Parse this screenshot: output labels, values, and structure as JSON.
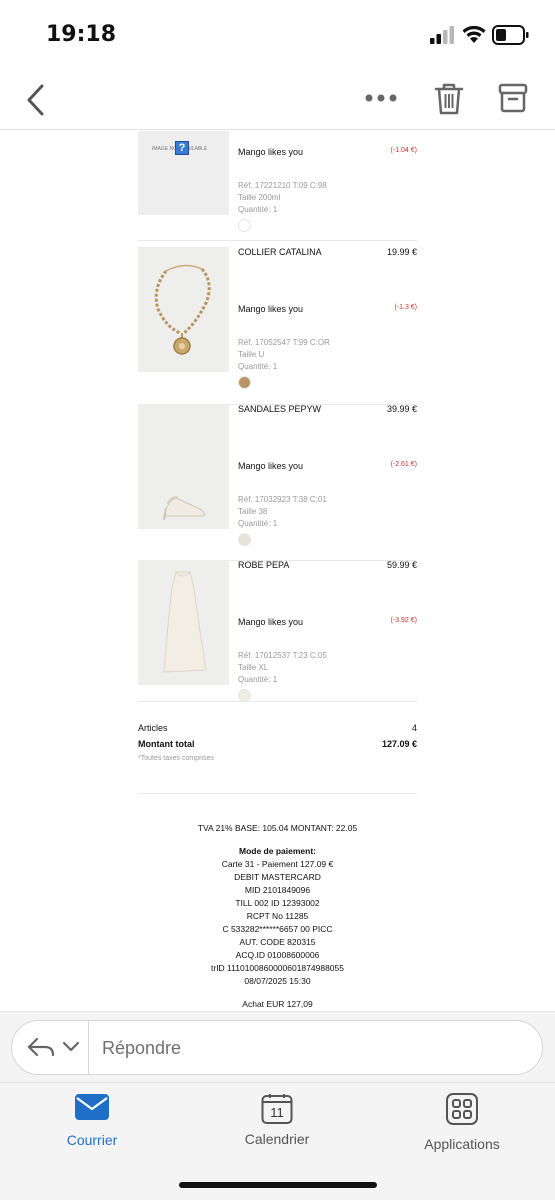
{
  "status_bar": {
    "time": "19:18"
  },
  "colors": {
    "accent": "#1f6fc6",
    "discount": "#d0302f",
    "muted": "#9a9a9a"
  },
  "items": [
    {
      "image_placeholder": "IMAGE NOT AVAILABLE",
      "name": "",
      "price": "",
      "promo": "Mango likes you",
      "discount": "(-1.04 €)",
      "ref": "Réf. 17221210 T:09 C:98",
      "size": "Taille 200ml",
      "qty": "Quantité: 1",
      "swatch_color": "#ffffff"
    },
    {
      "name": "COLLIER CATALINA",
      "price": "19.99 €",
      "promo": "Mango likes you",
      "discount": "(-1.3 €)",
      "ref": "Réf. 17052547 T:99 C:OR",
      "size": "Taille U",
      "qty": "Quantité: 1",
      "swatch_color": "#b89563"
    },
    {
      "name": "SANDALES PEPYW",
      "price": "39.99 €",
      "promo": "Mango likes you",
      "discount": "(-2.61 €)",
      "ref": "Réf. 17032923 T:38 C:01",
      "size": "Taille 38",
      "qty": "Quantité: 1",
      "swatch_color": "#e6e3dc"
    },
    {
      "name": "ROBE PEPA",
      "price": "59.99 €",
      "promo": "Mango likes you",
      "discount": "(-3.92 €)",
      "ref": "Réf. 17012537 T:23 C:05",
      "size": "Taille XL",
      "qty": "Quantité: 1",
      "swatch_color": "#f2ede3"
    }
  ],
  "totals": {
    "articles_label": "Articles",
    "articles_value": "4",
    "total_label": "Montant total",
    "total_value": "127.09 €",
    "tax_note": "*Toutes taxes comprises"
  },
  "receipt": {
    "tva": "TVA 21% BASE: 105.04 MONTANT: 22.05",
    "payment_title": "Mode de paiement:",
    "lines": [
      "Carte 31 - Paiement 127.09 €",
      "DEBIT MASTERCARD",
      "MID 2101849096",
      "TILL 002 ID 12393002",
      "RCPT No 11285",
      "C 533282******6657 00 PICC",
      "AUT. CODE 820315",
      "ACQ.ID 01008600006",
      "trID 1110100860000601874988055",
      "08/07/2025 15:30"
    ],
    "achat": "Achat EUR 127,09"
  },
  "reply": {
    "placeholder": "Répondre"
  },
  "tabs": [
    {
      "label": "Courrier",
      "icon": "mail-icon",
      "active": true
    },
    {
      "label": "Calendrier",
      "icon": "calendar-icon",
      "day": "11",
      "active": false
    },
    {
      "label": "Applications",
      "icon": "apps-grid-icon",
      "active": false
    }
  ]
}
